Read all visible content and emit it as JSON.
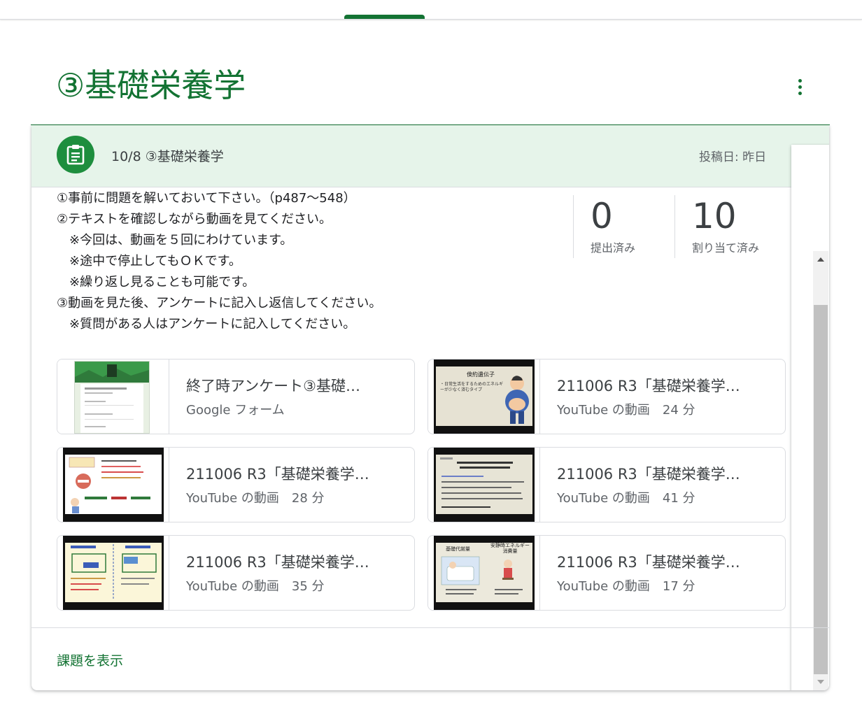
{
  "topic": {
    "title": "③基礎栄養学"
  },
  "post": {
    "title": "10/8 ③基礎栄養学",
    "posted": "投稿日: 昨日",
    "instructions": [
      "①事前に問題を解いておいて下さい。（p487～548）",
      "②テキストを確認しながら動画を見てください。",
      "　※今回は、動画を５回にわけています。",
      "　※途中で停止してもＯＫです。",
      "　※繰り返し見ることも可能です。",
      "③動画を見た後、アンケートに記入し返信してください。",
      "　※質問がある人はアンケートに記入してください。"
    ],
    "stats": [
      {
        "value": "0",
        "label": "提出済み"
      },
      {
        "value": "10",
        "label": "割り当て済み"
      }
    ],
    "attachments": [
      {
        "title": "終了時アンケート③基礎…",
        "subtitle": "Google フォーム",
        "type": "form"
      },
      {
        "title": "211006 R3「基礎栄養学…",
        "subtitle": "YouTube の動画　24 分",
        "type": "video",
        "thumb_heading": "倹約遺伝子",
        "thumb_text": "・日常生活をするためのエネルギーが少なく済むタイプ"
      },
      {
        "title": "211006 R3「基礎栄養学…",
        "subtitle": "YouTube の動画　28 分",
        "type": "video"
      },
      {
        "title": "211006 R3「基礎栄養学…",
        "subtitle": "YouTube の動画　41 分",
        "type": "video"
      },
      {
        "title": "211006 R3「基礎栄養学…",
        "subtitle": "YouTube の動画　35 分",
        "type": "video"
      },
      {
        "title": "211006 R3「基礎栄養学…",
        "subtitle": "YouTube の動画　17 分",
        "type": "video",
        "thumb_left": "基礎代謝量",
        "thumb_right": "安静時エネルギー消費量"
      }
    ],
    "view_link": "課題を表示"
  },
  "colors": {
    "accent": "#137333",
    "header_bg": "#e6f4ea",
    "icon_bg": "#1e8e3e"
  }
}
